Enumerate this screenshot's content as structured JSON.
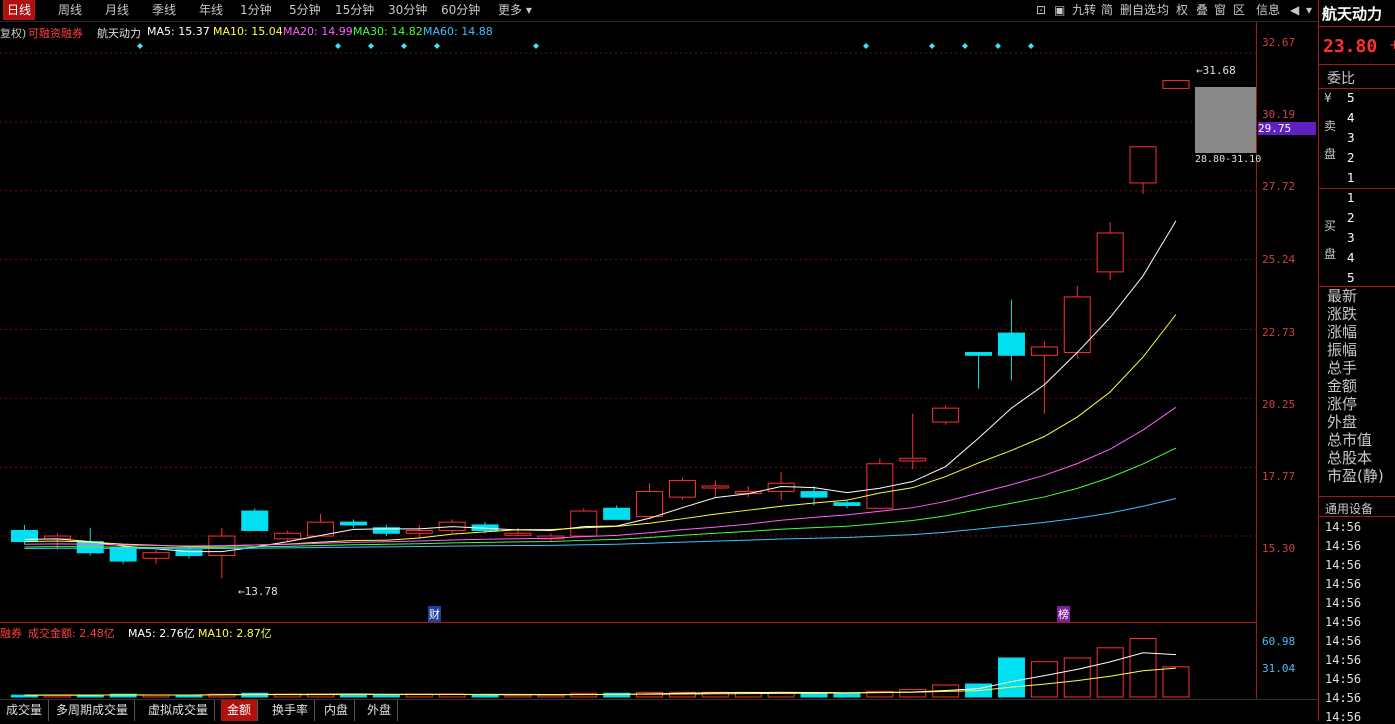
{
  "topbar": {
    "period_tabs": [
      "日线",
      "周线",
      "月线",
      "季线",
      "年线",
      "1分钟",
      "5分钟",
      "15分钟",
      "30分钟",
      "60分钟",
      "更多 ▾"
    ],
    "active_tab": "日线",
    "tools": [
      "⊡",
      "▣",
      "九转",
      "简",
      "删自选",
      "均",
      "权",
      "叠",
      "窗",
      "区",
      "信息",
      "◀",
      "▾"
    ]
  },
  "info": {
    "prefix": "复权)",
    "margin_label": "可融资融券",
    "stock_name": "航天动力",
    "ma5": "MA5: 15.37",
    "ma10": "MA10: 15.04",
    "ma20": "MA20: 14.99",
    "ma30": "MA30: 14.82",
    "ma60": "MA60: 14.88"
  },
  "price_axis": [
    "32.67",
    "30.19",
    "27.72",
    "25.24",
    "22.73",
    "20.25",
    "17.77",
    "15.30"
  ],
  "current_price_tag": "29.75",
  "annotations": {
    "high_label": "31.68",
    "low_label": "13.78",
    "range_label": "28.80-31.10",
    "marker_cai": "财",
    "marker_bang": "榜"
  },
  "volume": {
    "prefix": "融券",
    "label": "成交金额: 2.48亿",
    "ma5": "MA5: 2.76亿",
    "ma10": "MA10: 2.87亿",
    "axis": [
      "60.98",
      "31.04"
    ]
  },
  "right_panel": {
    "stock_name": "航天动力",
    "price": "23.80",
    "plus": "+",
    "weibi": "委比",
    "sell_label_1": "¥",
    "sell_label_2": "卖",
    "sell_label_3": "盘",
    "sell_levels": [
      "5",
      "4",
      "3",
      "2",
      "1"
    ],
    "buy_label_1": "买",
    "buy_label_2": "盘",
    "buy_levels": [
      "1",
      "2",
      "3",
      "4",
      "5"
    ],
    "fields": [
      "最新",
      "涨跌",
      "涨幅",
      "振幅",
      "总手",
      "金额",
      "涨停",
      "外盘",
      "总市值",
      "总股本",
      "市盈(静)"
    ],
    "device": "通用设备",
    "times": [
      "14:56",
      "14:56",
      "14:56",
      "14:56",
      "14:56",
      "14:56",
      "14:56",
      "14:56",
      "14:56",
      "14:56",
      "14:56"
    ]
  },
  "bottom_tabs": [
    "成交量",
    "多周期成交量",
    "虚拟成交量",
    "金额",
    "换手率",
    "内盘",
    "外盘"
  ],
  "bottom_active": "金额",
  "colors": {
    "up": "#ff3030",
    "down": "#00e0f0",
    "ma5": "#ffffff",
    "ma10": "#ffff40",
    "ma20": "#ff60ff",
    "ma30": "#40ff40",
    "ma60": "#40c0ff",
    "axis": "#d04040"
  },
  "chart_data": {
    "type": "candlestick",
    "price_range": [
      13.0,
      33.5
    ],
    "candles": [
      {
        "o": 15.5,
        "h": 15.7,
        "l": 15.0,
        "c": 15.1
      },
      {
        "o": 15.2,
        "h": 15.4,
        "l": 14.8,
        "c": 15.3
      },
      {
        "o": 15.1,
        "h": 15.6,
        "l": 14.6,
        "c": 14.7
      },
      {
        "o": 14.9,
        "h": 15.0,
        "l": 14.3,
        "c": 14.4
      },
      {
        "o": 14.5,
        "h": 14.8,
        "l": 14.3,
        "c": 14.7
      },
      {
        "o": 14.8,
        "h": 14.9,
        "l": 14.5,
        "c": 14.6
      },
      {
        "o": 14.6,
        "h": 15.6,
        "l": 13.78,
        "c": 15.3
      },
      {
        "o": 16.2,
        "h": 16.3,
        "l": 15.5,
        "c": 15.5
      },
      {
        "o": 15.2,
        "h": 15.5,
        "l": 15.1,
        "c": 15.4
      },
      {
        "o": 15.3,
        "h": 16.1,
        "l": 15.3,
        "c": 15.8
      },
      {
        "o": 15.8,
        "h": 15.9,
        "l": 15.6,
        "c": 15.7
      },
      {
        "o": 15.6,
        "h": 15.7,
        "l": 15.3,
        "c": 15.4
      },
      {
        "o": 15.4,
        "h": 15.7,
        "l": 15.2,
        "c": 15.5
      },
      {
        "o": 15.5,
        "h": 15.9,
        "l": 15.4,
        "c": 15.8
      },
      {
        "o": 15.7,
        "h": 15.8,
        "l": 15.4,
        "c": 15.5
      },
      {
        "o": 15.4,
        "h": 15.6,
        "l": 15.3,
        "c": 15.4
      },
      {
        "o": 15.2,
        "h": 15.4,
        "l": 15.1,
        "c": 15.3
      },
      {
        "o": 15.3,
        "h": 16.3,
        "l": 15.3,
        "c": 16.2
      },
      {
        "o": 16.3,
        "h": 16.4,
        "l": 15.9,
        "c": 15.9
      },
      {
        "o": 16.0,
        "h": 17.2,
        "l": 15.9,
        "c": 16.9
      },
      {
        "o": 16.7,
        "h": 17.4,
        "l": 16.6,
        "c": 17.3
      },
      {
        "o": 17.1,
        "h": 17.3,
        "l": 16.7,
        "c": 17.1
      },
      {
        "o": 16.9,
        "h": 17.1,
        "l": 16.7,
        "c": 16.9
      },
      {
        "o": 16.9,
        "h": 17.6,
        "l": 16.6,
        "c": 17.2
      },
      {
        "o": 16.9,
        "h": 17.1,
        "l": 16.4,
        "c": 16.7
      },
      {
        "o": 16.5,
        "h": 16.6,
        "l": 16.3,
        "c": 16.4
      },
      {
        "o": 16.3,
        "h": 18.1,
        "l": 16.3,
        "c": 17.9
      },
      {
        "o": 18.0,
        "h": 19.7,
        "l": 17.7,
        "c": 18.1
      },
      {
        "o": 19.4,
        "h": 20.0,
        "l": 19.3,
        "c": 19.9
      },
      {
        "o": 21.9,
        "h": 21.9,
        "l": 20.6,
        "c": 21.8
      },
      {
        "o": 22.6,
        "h": 23.8,
        "l": 20.9,
        "c": 21.8
      },
      {
        "o": 21.8,
        "h": 22.3,
        "l": 19.7,
        "c": 22.1
      },
      {
        "o": 21.9,
        "h": 24.3,
        "l": 21.7,
        "c": 23.9
      },
      {
        "o": 24.8,
        "h": 26.6,
        "l": 24.5,
        "c": 26.2
      },
      {
        "o": 28.0,
        "h": 29.3,
        "l": 27.6,
        "c": 29.3
      },
      {
        "o": 31.4,
        "h": 31.68,
        "l": 31.4,
        "c": 31.68
      }
    ],
    "amount_range": [
      0,
      70
    ],
    "amounts": [
      2,
      2,
      2,
      3,
      2,
      2,
      3,
      4,
      3,
      3,
      3,
      2,
      3,
      3,
      2,
      2,
      2,
      4,
      4,
      5,
      5,
      5,
      5,
      5,
      4,
      4,
      6,
      8,
      13,
      14,
      42,
      38,
      42,
      53,
      63,
      32.5
    ]
  }
}
